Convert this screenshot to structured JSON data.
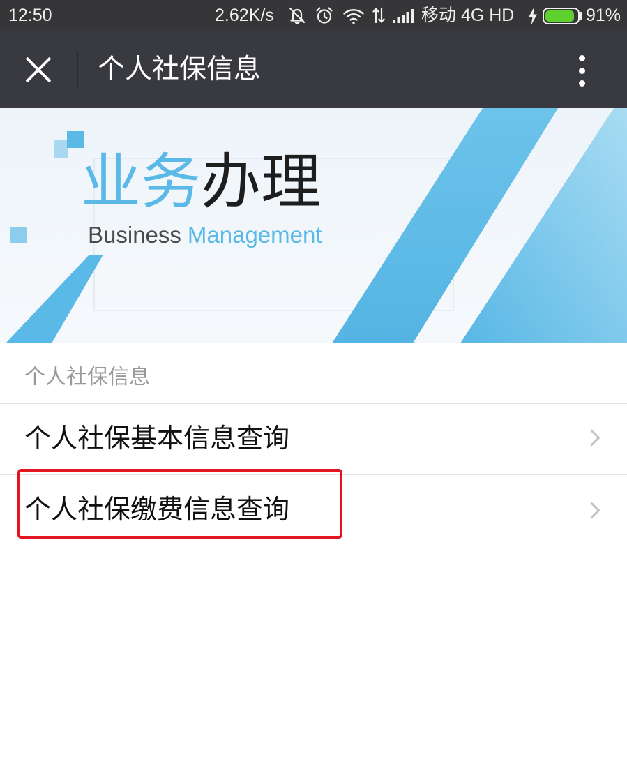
{
  "status_bar": {
    "time": "12:50",
    "network_speed": "2.62K/s",
    "carrier": "移动 4G HD",
    "battery_percent": "91%",
    "battery_level": 0.91,
    "icons": {
      "mute": "mute-icon",
      "alarm": "alarm-icon",
      "wifi": "wifi-icon",
      "data": "data-arrows-icon",
      "signal": "signal-icon",
      "charging": "charging-icon",
      "battery": "battery-icon"
    }
  },
  "nav_bar": {
    "title": "个人社保信息",
    "close_icon": "close-icon",
    "more_icon": "more-vertical-icon"
  },
  "banner": {
    "title_accent": "业务",
    "title_main": "办理",
    "subtitle_main": "Business",
    "subtitle_accent": "Management"
  },
  "section": {
    "header": "个人社保信息",
    "items": [
      {
        "label": "个人社保基本信息查询"
      },
      {
        "label": "个人社保缴费信息查询"
      }
    ],
    "chevron_icon": "chevron-right-icon"
  },
  "colors": {
    "status_bar_bg": "#363638",
    "nav_bar_bg": "#393a3f",
    "accent_blue": "#5ab9e6",
    "battery_green": "#5fd12e",
    "highlight_red": "#e3161f",
    "section_header_text": "#999999",
    "divider": "#e5e5e5"
  }
}
